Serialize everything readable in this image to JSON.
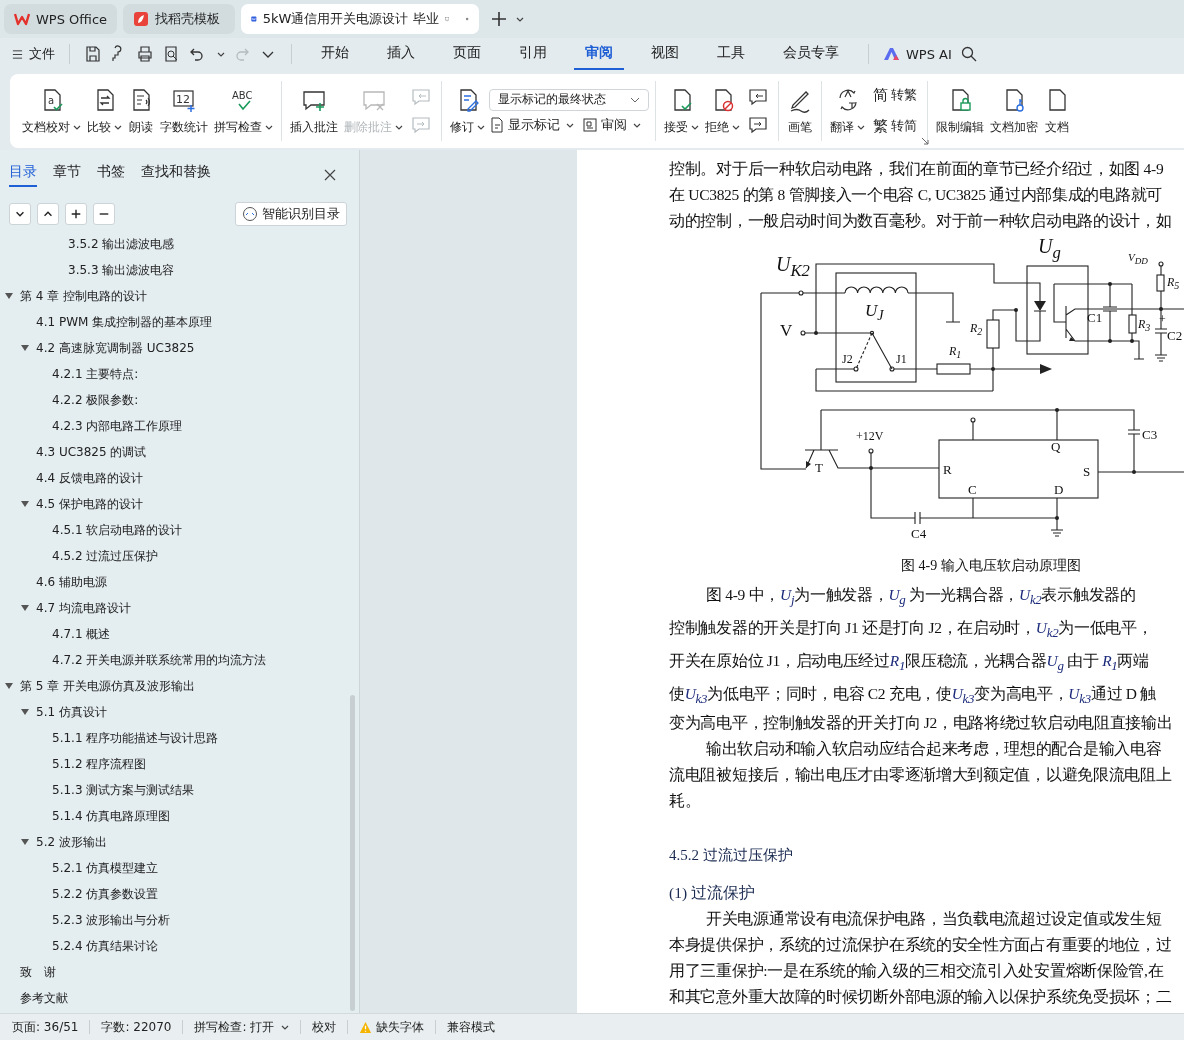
{
  "tabs": [
    {
      "label": "WPS Office",
      "selected": false
    },
    {
      "label": "找稻壳模板",
      "selected": false
    },
    {
      "label": "5kW通信用开关电源设计 毕业",
      "selected": true
    }
  ],
  "menu": {
    "file": "文件",
    "quick_actions": [
      {
        "disabled": false
      },
      {
        "disabled": false
      },
      {
        "disabled": false
      },
      {
        "disabled": false
      },
      {
        "disabled": false
      },
      {
        "disabled": true
      }
    ],
    "tabs": [
      {
        "label": "开始",
        "selected": false
      },
      {
        "label": "插入",
        "selected": false
      },
      {
        "label": "页面",
        "selected": false
      },
      {
        "label": "引用",
        "selected": false
      },
      {
        "label": "审阅",
        "selected": true
      },
      {
        "label": "视图",
        "selected": false
      },
      {
        "label": "工具",
        "selected": false
      },
      {
        "label": "会员专享",
        "selected": false
      }
    ],
    "ai": "WPS AI"
  },
  "ribbon": {
    "groups": [
      {
        "launcher": false,
        "items": [
          {
            "kind": "big",
            "label": "文档校对",
            "caret": true,
            "disabled": false,
            "icon_text": "a"
          },
          {
            "kind": "big",
            "label": "比较",
            "caret": true,
            "disabled": false
          },
          {
            "kind": "big",
            "label": "朗读",
            "caret": false,
            "disabled": false
          },
          {
            "kind": "big",
            "label": "字数统计",
            "caret": false,
            "disabled": false,
            "icon_text": "12"
          },
          {
            "kind": "big",
            "label": "拼写检查",
            "caret": true,
            "disabled": false,
            "icon_text": "ABC"
          }
        ]
      },
      {
        "launcher": false,
        "items": [
          {
            "kind": "big",
            "label": "插入批注",
            "caret": false,
            "disabled": false
          },
          {
            "kind": "big",
            "label": "删除批注",
            "caret": true,
            "disabled": true
          },
          {
            "kind": "icon-stack",
            "buttons": [
              {
                "disabled": true
              },
              {
                "disabled": true
              }
            ]
          }
        ]
      },
      {
        "launcher": false,
        "items": [
          {
            "kind": "big",
            "label": "修订",
            "caret": true,
            "disabled": false
          },
          {
            "kind": "markup",
            "select": "显示标记的最终状态",
            "buttons": [
              {
                "label": "显示标记",
                "caret": true
              },
              {
                "label": "审阅",
                "caret": true
              }
            ]
          }
        ]
      },
      {
        "launcher": false,
        "items": [
          {
            "kind": "big",
            "label": "接受",
            "caret": true,
            "disabled": false
          },
          {
            "kind": "big",
            "label": "拒绝",
            "caret": true,
            "disabled": false
          },
          {
            "kind": "icon-stack",
            "buttons": [
              {
                "disabled": false
              },
              {
                "disabled": false
              }
            ]
          }
        ]
      },
      {
        "launcher": false,
        "items": [
          {
            "kind": "big",
            "label": "画笔",
            "caret": false,
            "disabled": false
          }
        ]
      },
      {
        "launcher": true,
        "items": [
          {
            "kind": "big",
            "label": "翻译",
            "caret": true,
            "disabled": false
          },
          {
            "kind": "text-stack",
            "buttons": [
              {
                "icon_text": "简",
                "label": "转繁"
              },
              {
                "icon_text": "繁",
                "label": "转简"
              }
            ]
          }
        ]
      },
      {
        "launcher": false,
        "items": [
          {
            "kind": "big",
            "label": "限制编辑",
            "caret": false,
            "disabled": false
          },
          {
            "kind": "big",
            "label": "文档加密",
            "caret": false,
            "disabled": false
          },
          {
            "kind": "big",
            "label": "文档",
            "caret": false,
            "disabled": false
          }
        ]
      }
    ]
  },
  "sidebar": {
    "tabs": [
      {
        "label": "目录",
        "selected": true
      },
      {
        "label": "章节",
        "selected": false
      },
      {
        "label": "书签",
        "selected": false
      },
      {
        "label": "查找和替换",
        "selected": false
      }
    ],
    "smart_button": "智能识别目录",
    "toc": {
      "leading_items": [
        "3.5.2  输出滤波电感",
        "3.5.3  输出滤波电容"
      ],
      "items": [
        {
          "label": "第 4 章  控制电路的设计",
          "expanded": true,
          "children": [
            {
              "label": "4.1 PWM 集成控制器的基本原理"
            },
            {
              "label": "4.2  高速脉宽调制器 UC3825",
              "expanded": true,
              "children": [
                {
                  "label": "4.2.1  主要特点:"
                },
                {
                  "label": "4.2.2  极限参数:"
                },
                {
                  "label": "4.2.3  内部电路工作原理"
                }
              ]
            },
            {
              "label": "4.3    UC3825 的调试"
            },
            {
              "label": "4.4  反馈电路的设计"
            },
            {
              "label": "4.5 保护电路的设计",
              "expanded": true,
              "children": [
                {
                  "label": "4.5.1 软启动电路的设计"
                },
                {
                  "label": "4.5.2 过流过压保护"
                }
              ]
            },
            {
              "label": "4.6  辅助电源"
            },
            {
              "label": "4.7  均流电路设计",
              "expanded": true,
              "children": [
                {
                  "label": "4.7.1  概述"
                },
                {
                  "label": "4.7.2  开关电源并联系统常用的均流方法"
                }
              ]
            }
          ]
        },
        {
          "label": "第 5 章  开关电源仿真及波形输出",
          "expanded": true,
          "children": [
            {
              "label": "5.1 仿真设计",
              "expanded": true,
              "children": [
                {
                  "label": "5.1.1 程序功能描述与设计思路"
                },
                {
                  "label": "5.1.2 程序流程图"
                },
                {
                  "label": "5.1.3 测试方案与测试结果"
                },
                {
                  "label": "5.1.4 仿真电路原理图"
                }
              ]
            },
            {
              "label": "5.2  波形输出",
              "expanded": true,
              "children": [
                {
                  "label": "5.2.1  仿真模型建立"
                },
                {
                  "label": "5.2.2  仿真参数设置"
                },
                {
                  "label": "5.2.3  波形输出与分析"
                },
                {
                  "label": "5.2.4  仿真结果讨论"
                }
              ]
            }
          ]
        },
        {
          "label": "致　谢"
        },
        {
          "label": "参考文献"
        }
      ]
    }
  },
  "document": [
    {
      "kind": "line",
      "text": "控制。对于后一种软启动电路，我们在前面的章节已经介绍过，如图 4-9"
    },
    {
      "kind": "line",
      "text": "在 UC3825 的第 8 管脚接入一个电容 C, UC3825 通过内部集成的电路就可"
    },
    {
      "kind": "line",
      "text": "动的控制，一般启动时间为数百毫秒。对于前一种软启动电路的设计，如"
    },
    {
      "kind": "figure",
      "labels": [
        "U$_{K2}$",
        "V",
        "U$_{J}$",
        "J2",
        "J1",
        "R$_{1}$",
        "R$_{2}$",
        "U$_{g}$",
        "V$_{DD}$",
        "R$_{5}$",
        "C1",
        "R$_{3}$",
        "+",
        "C2",
        "T",
        "+12V",
        "R",
        "Q",
        "S",
        "C",
        "D",
        "C3",
        "C4"
      ]
    },
    {
      "kind": "caption",
      "text": "图 4-9 输入电压软启动原理图"
    },
    {
      "kind": "math-indent",
      "parts": [
        {
          "text": "图 4-9 中，"
        },
        {
          "var": "U",
          "sub": "j"
        },
        {
          "text": "为一触发器，"
        },
        {
          "var": "U",
          "sub": "g"
        },
        {
          "text": " 为一光耦合器，"
        },
        {
          "var": "U",
          "sub": "k2"
        },
        {
          "text": "表示触发器的"
        }
      ]
    },
    {
      "kind": "math",
      "parts": [
        {
          "text": "控制触发器的开关是打向 J1 还是打向 J2，在启动时，"
        },
        {
          "var": "U",
          "sub": "k2"
        },
        {
          "text": "为一低电平，"
        }
      ]
    },
    {
      "kind": "math",
      "parts": [
        {
          "text": "开关在原始位 J1，启动电压经过"
        },
        {
          "var": "R",
          "sub": "1"
        },
        {
          "text": "限压稳流，光耦合器"
        },
        {
          "var": "U",
          "sub": "g"
        },
        {
          "text": " 由于 "
        },
        {
          "var": "R",
          "sub": "1"
        },
        {
          "text": "两端"
        }
      ]
    },
    {
      "kind": "math",
      "parts": [
        {
          "text": "使"
        },
        {
          "var": "U",
          "sub": "k3"
        },
        {
          "text": "为低电平；同时，电容 C2 充电，使"
        },
        {
          "var": "U",
          "sub": "k3"
        },
        {
          "text": "变为高电平，"
        },
        {
          "var": "U",
          "sub": "k3"
        },
        {
          "text": "通过 D 触"
        }
      ]
    },
    {
      "kind": "line",
      "text": "变为高电平，控制触发器的开关打向 J2，电路将绕过软启动电阻直接输出"
    },
    {
      "kind": "indent",
      "text": "输出软启动和输入软启动应结合起来考虑，理想的配合是输入电容"
    },
    {
      "kind": "line",
      "text": "流电阻被短接后，输出电压才由零逐渐增大到额定值，以避免限流电阻上"
    },
    {
      "kind": "line",
      "text": "耗。"
    },
    {
      "kind": "heading",
      "text": "4.5.2 过流过压保护"
    },
    {
      "kind": "subheading",
      "text": "(1)  过流保护"
    },
    {
      "kind": "indent",
      "text": "开关电源通常设有电流保护电路，当负载电流超过设定值或发生短"
    },
    {
      "kind": "line",
      "text": "本身提供保护，系统的过流保护在系统的安全性方面占有重要的地位，过"
    },
    {
      "kind": "line",
      "text": "用了三重保护:一是在系统的输入级的三相交流引入处安置熔断保险管,在"
    },
    {
      "kind": "line",
      "text": "和其它意外重大故障的时候切断外部电源的输入以保护系统免受损坏；二"
    }
  ],
  "status_bar": [
    {
      "label": "页面: 36/51",
      "caret": false,
      "warning": false
    },
    {
      "label": "字数: 22070",
      "caret": false,
      "warning": false
    },
    {
      "label": "拼写检查: 打开",
      "caret": true,
      "warning": false
    },
    {
      "label": "校对",
      "caret": false,
      "warning": false
    },
    {
      "label": "缺失字体",
      "caret": false,
      "warning": true
    },
    {
      "label": "兼容模式",
      "caret": false,
      "warning": false
    }
  ]
}
